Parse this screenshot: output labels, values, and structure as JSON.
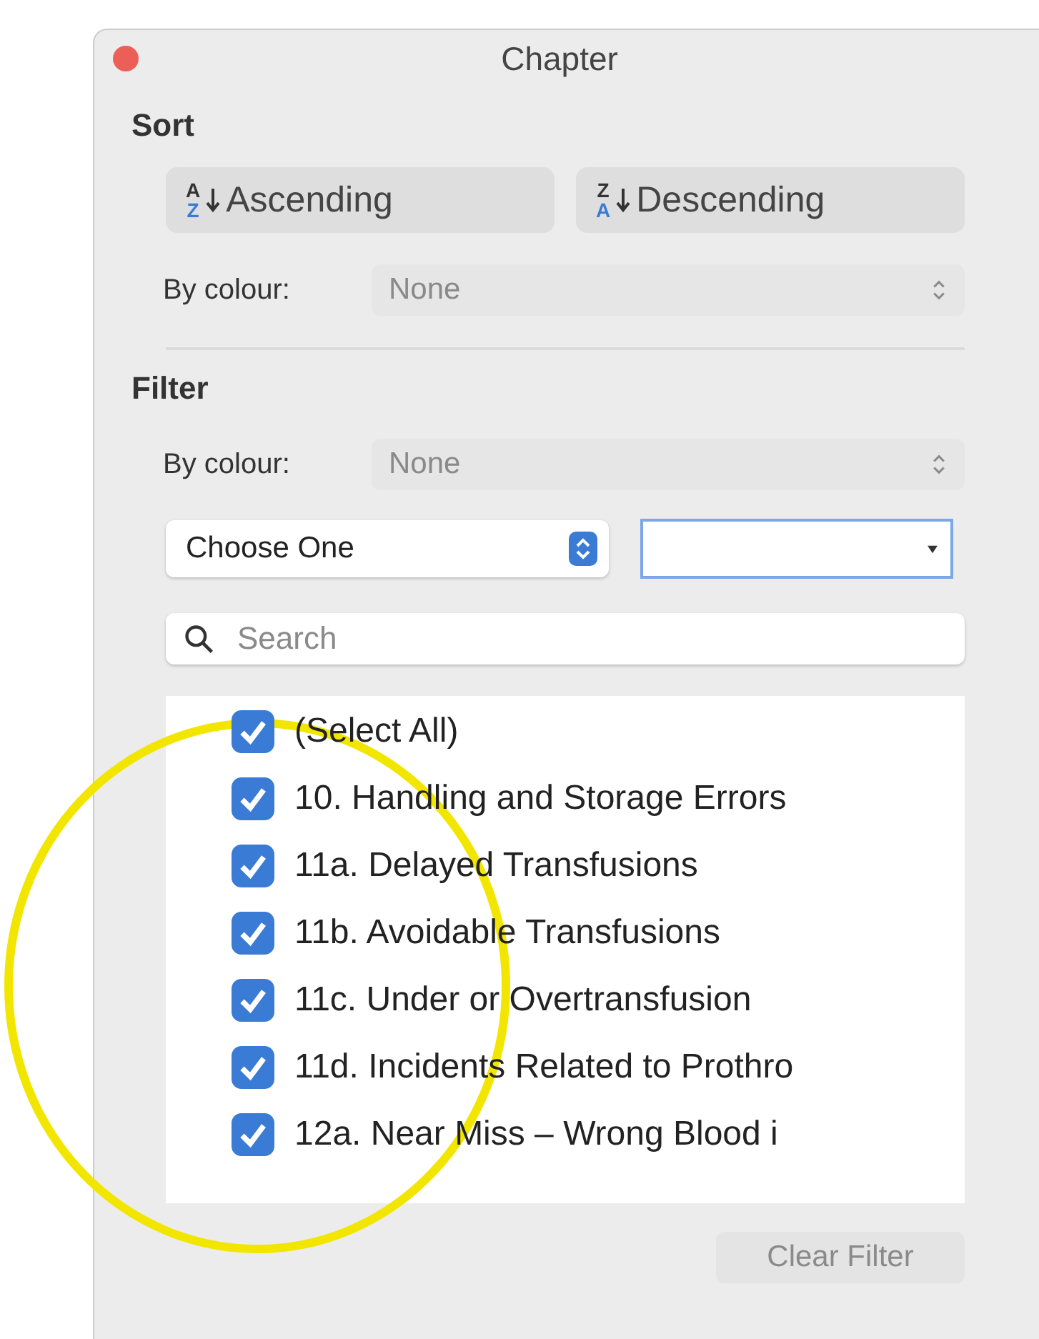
{
  "window": {
    "title": "Chapter"
  },
  "sort": {
    "title": "Sort",
    "buttons": [
      {
        "label": "Ascending",
        "glyph_top": "A",
        "glyph_bottom": "Z"
      },
      {
        "label": "Descending",
        "glyph_top": "Z",
        "glyph_bottom": "A"
      }
    ],
    "by_colour": {
      "label": "By colour:",
      "value": "None",
      "disabled": true
    }
  },
  "filter": {
    "title": "Filter",
    "by_colour": {
      "label": "By colour:",
      "value": "None",
      "disabled": true
    },
    "condition": {
      "value": "Choose One"
    },
    "search": {
      "placeholder": "Search"
    },
    "items": [
      {
        "label": "(Select All)",
        "checked": true
      },
      {
        "label": "10. Handling and Storage Errors",
        "checked": true
      },
      {
        "label": "11a. Delayed Transfusions",
        "checked": true
      },
      {
        "label": "11b. Avoidable Transfusions",
        "checked": true
      },
      {
        "label": "11c. Under or Overtransfusion",
        "checked": true
      },
      {
        "label": "11d. Incidents Related to Prothro",
        "checked": true
      },
      {
        "label": "12a. Near Miss – Wrong Blood i",
        "checked": true
      }
    ],
    "clear_button": {
      "label": "Clear Filter",
      "disabled": true
    }
  }
}
